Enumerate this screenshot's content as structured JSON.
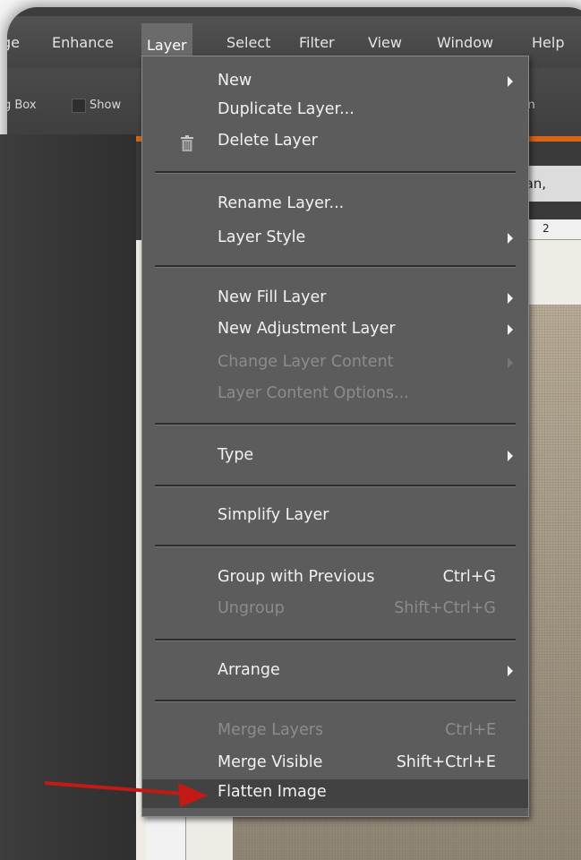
{
  "menubar": {
    "items": [
      {
        "label": "ge"
      },
      {
        "label": "Enhance"
      },
      {
        "label": "Layer"
      },
      {
        "label": "Select"
      },
      {
        "label": "Filter"
      },
      {
        "label": "View"
      },
      {
        "label": "Window"
      },
      {
        "label": "Help"
      }
    ],
    "active": "Layer"
  },
  "options_bar": {
    "bounding_box_label": "g Box",
    "show_label": "Show",
    "align_label": "lign"
  },
  "document": {
    "tab_label": "man,",
    "ruler_label": "2"
  },
  "layer_menu": {
    "items": [
      {
        "label": "New",
        "submenu": true,
        "enabled": true
      },
      {
        "label": "Duplicate Layer...",
        "enabled": true
      },
      {
        "label": "Delete Layer",
        "enabled": true,
        "icon": "trash-icon"
      },
      {
        "label": "Rename Layer...",
        "enabled": true
      },
      {
        "label": "Layer Style",
        "submenu": true,
        "enabled": true
      },
      {
        "label": "New Fill Layer",
        "submenu": true,
        "enabled": true
      },
      {
        "label": "New Adjustment Layer",
        "submenu": true,
        "enabled": true
      },
      {
        "label": "Change Layer Content",
        "submenu": true,
        "enabled": false
      },
      {
        "label": "Layer Content Options...",
        "enabled": false
      },
      {
        "label": "Type",
        "submenu": true,
        "enabled": true
      },
      {
        "label": "Simplify Layer",
        "enabled": true
      },
      {
        "label": "Group with Previous",
        "shortcut": "Ctrl+G",
        "enabled": true
      },
      {
        "label": "Ungroup",
        "shortcut": "Shift+Ctrl+G",
        "enabled": false
      },
      {
        "label": "Arrange",
        "submenu": true,
        "enabled": true
      },
      {
        "label": "Merge Layers",
        "shortcut": "Ctrl+E",
        "enabled": false
      },
      {
        "label": "Merge Visible",
        "shortcut": "Shift+Ctrl+E",
        "enabled": true
      },
      {
        "label": "Flatten Image",
        "enabled": true,
        "highlighted": true
      }
    ]
  },
  "colors": {
    "accent_orange": "#d9641a",
    "annotation_arrow": "#c41a16",
    "menu_bg": "#5c5c5c"
  }
}
